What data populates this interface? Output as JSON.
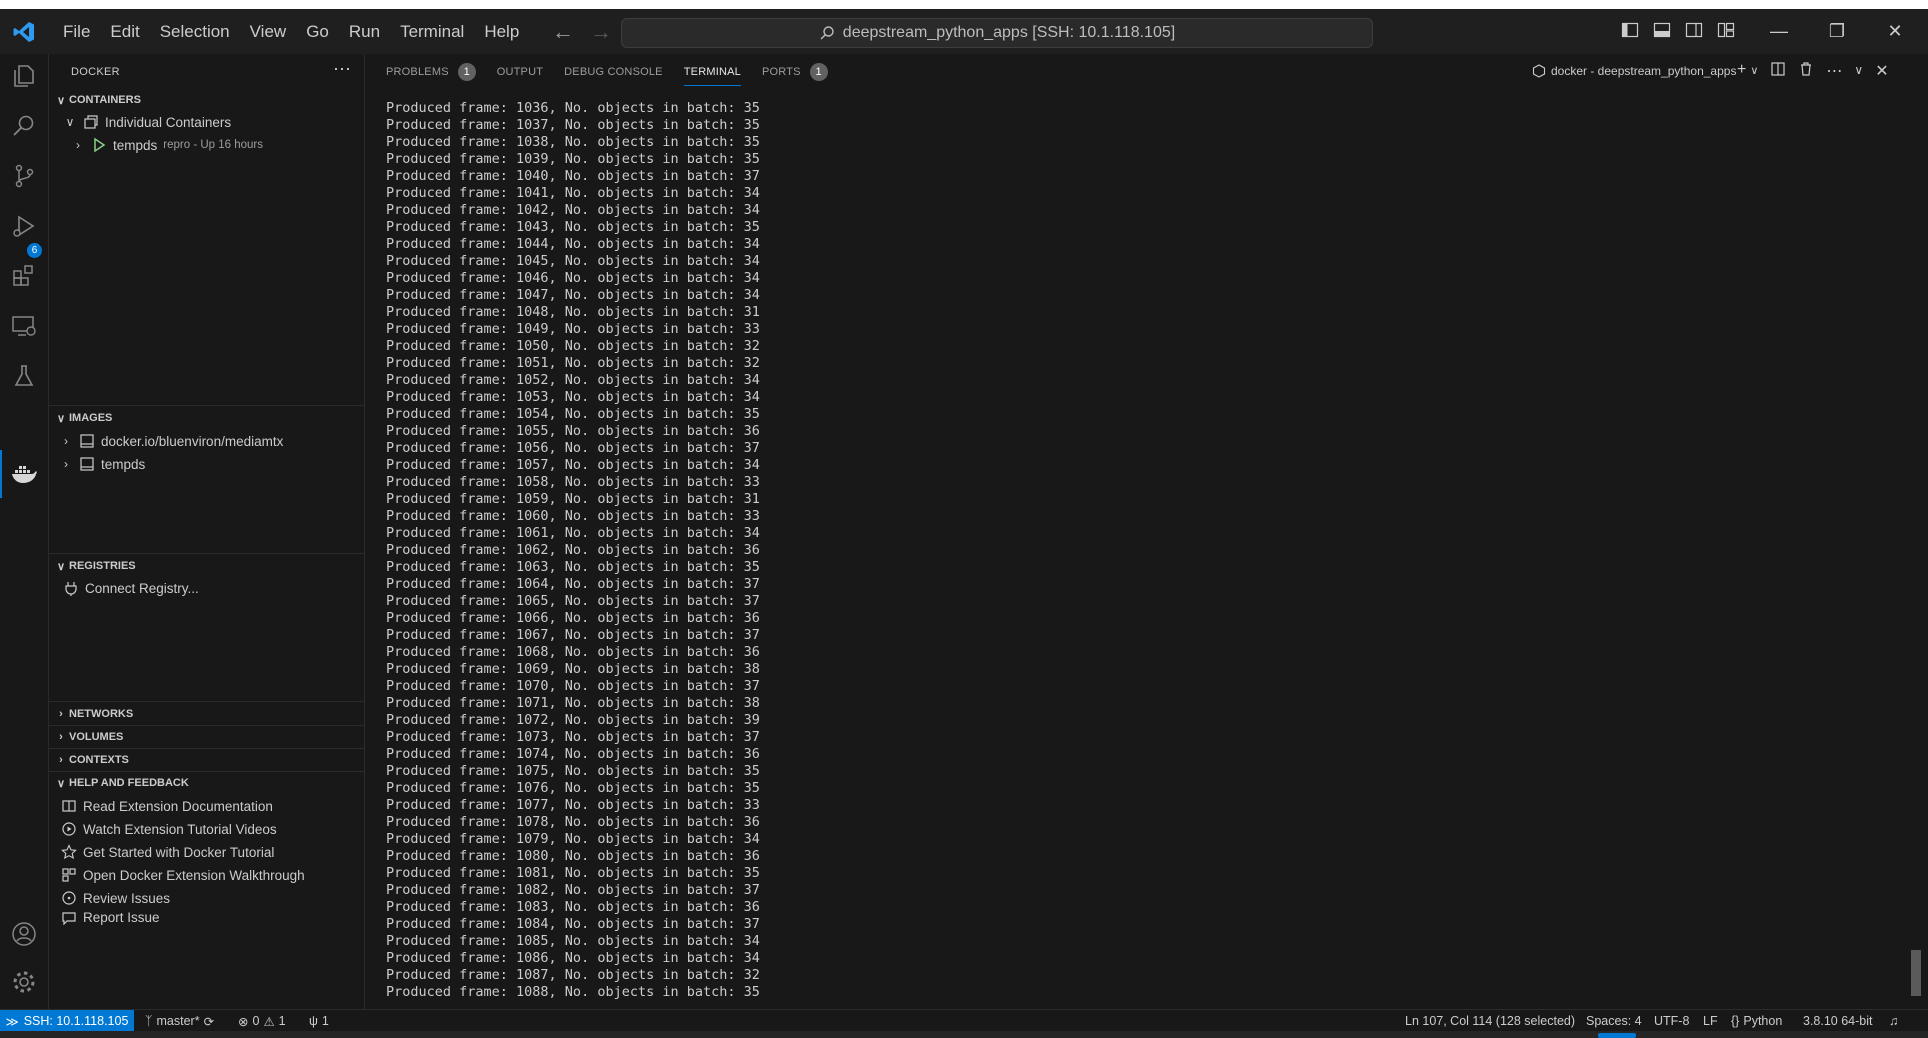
{
  "titlebar": {
    "menus": [
      "File",
      "Edit",
      "Selection",
      "View",
      "Go",
      "Run",
      "Terminal",
      "Help"
    ],
    "command_center": "deepstream_python_apps [SSH: 10.1.118.105]"
  },
  "activity_bar": {
    "icons": [
      "explorer-icon",
      "search-icon",
      "source-control-icon",
      "run-debug-icon",
      "extensions-icon",
      "remote-explorer-icon",
      "testing-icon",
      "docker-icon",
      "account-icon",
      "settings-gear-icon"
    ],
    "source_control_badge": "6"
  },
  "sidebar": {
    "title": "DOCKER",
    "containers": {
      "header": "CONTAINERS",
      "group": "Individual Containers",
      "items": [
        {
          "name": "tempds",
          "description": "repro - Up 16 hours"
        }
      ]
    },
    "images": {
      "header": "IMAGES",
      "items": [
        "docker.io/bluenviron/mediamtx",
        "tempds"
      ]
    },
    "registries": {
      "header": "REGISTRIES",
      "items": [
        "Connect Registry..."
      ]
    },
    "networks": {
      "header": "NETWORKS"
    },
    "volumes": {
      "header": "VOLUMES"
    },
    "contexts": {
      "header": "CONTEXTS"
    },
    "help": {
      "header": "HELP AND FEEDBACK",
      "items": [
        "Read Extension Documentation",
        "Watch Extension Tutorial Videos",
        "Get Started with Docker Tutorial",
        "Open Docker Extension Walkthrough",
        "Review Issues",
        "Report Issue"
      ]
    }
  },
  "panel": {
    "tabs": [
      {
        "label": "PROBLEMS",
        "badge": "1"
      },
      {
        "label": "OUTPUT"
      },
      {
        "label": "DEBUG CONSOLE"
      },
      {
        "label": "TERMINAL",
        "active": true
      },
      {
        "label": "PORTS",
        "badge": "1"
      }
    ],
    "terminal_name": "docker - deepstream_python_apps",
    "terminal_lines": [
      "Produced frame: 1036, No. objects in batch: 35",
      "Produced frame: 1037, No. objects in batch: 35",
      "Produced frame: 1038, No. objects in batch: 35",
      "Produced frame: 1039, No. objects in batch: 35",
      "Produced frame: 1040, No. objects in batch: 37",
      "Produced frame: 1041, No. objects in batch: 34",
      "Produced frame: 1042, No. objects in batch: 34",
      "Produced frame: 1043, No. objects in batch: 35",
      "Produced frame: 1044, No. objects in batch: 34",
      "Produced frame: 1045, No. objects in batch: 34",
      "Produced frame: 1046, No. objects in batch: 34",
      "Produced frame: 1047, No. objects in batch: 34",
      "Produced frame: 1048, No. objects in batch: 31",
      "Produced frame: 1049, No. objects in batch: 33",
      "Produced frame: 1050, No. objects in batch: 32",
      "Produced frame: 1051, No. objects in batch: 32",
      "Produced frame: 1052, No. objects in batch: 34",
      "Produced frame: 1053, No. objects in batch: 34",
      "Produced frame: 1054, No. objects in batch: 35",
      "Produced frame: 1055, No. objects in batch: 36",
      "Produced frame: 1056, No. objects in batch: 37",
      "Produced frame: 1057, No. objects in batch: 34",
      "Produced frame: 1058, No. objects in batch: 33",
      "Produced frame: 1059, No. objects in batch: 31",
      "Produced frame: 1060, No. objects in batch: 33",
      "Produced frame: 1061, No. objects in batch: 34",
      "Produced frame: 1062, No. objects in batch: 36",
      "Produced frame: 1063, No. objects in batch: 35",
      "Produced frame: 1064, No. objects in batch: 37",
      "Produced frame: 1065, No. objects in batch: 37",
      "Produced frame: 1066, No. objects in batch: 36",
      "Produced frame: 1067, No. objects in batch: 37",
      "Produced frame: 1068, No. objects in batch: 36",
      "Produced frame: 1069, No. objects in batch: 38",
      "Produced frame: 1070, No. objects in batch: 37",
      "Produced frame: 1071, No. objects in batch: 38",
      "Produced frame: 1072, No. objects in batch: 39",
      "Produced frame: 1073, No. objects in batch: 37",
      "Produced frame: 1074, No. objects in batch: 36",
      "Produced frame: 1075, No. objects in batch: 35",
      "Produced frame: 1076, No. objects in batch: 35",
      "Produced frame: 1077, No. objects in batch: 33",
      "Produced frame: 1078, No. objects in batch: 36",
      "Produced frame: 1079, No. objects in batch: 34",
      "Produced frame: 1080, No. objects in batch: 36",
      "Produced frame: 1081, No. objects in batch: 35",
      "Produced frame: 1082, No. objects in batch: 37",
      "Produced frame: 1083, No. objects in batch: 36",
      "Produced frame: 1084, No. objects in batch: 37",
      "Produced frame: 1085, No. objects in batch: 34",
      "Produced frame: 1086, No. objects in batch: 34",
      "Produced frame: 1087, No. objects in batch: 32",
      "Produced frame: 1088, No. objects in batch: 35"
    ]
  },
  "statusbar": {
    "remote": "SSH: 10.1.118.105",
    "branch": "master*",
    "errors": "0",
    "warnings": "1",
    "ports": "1",
    "cursor": "Ln 107, Col 114 (128 selected)",
    "spaces": "Spaces: 4",
    "encoding": "UTF-8",
    "eol": "LF",
    "language": "Python",
    "interpreter": "3.8.10 64-bit"
  },
  "colors": {
    "accent": "#0078d4",
    "background": "#181818",
    "foreground": "#cccccc",
    "run_green": "#89d185"
  }
}
